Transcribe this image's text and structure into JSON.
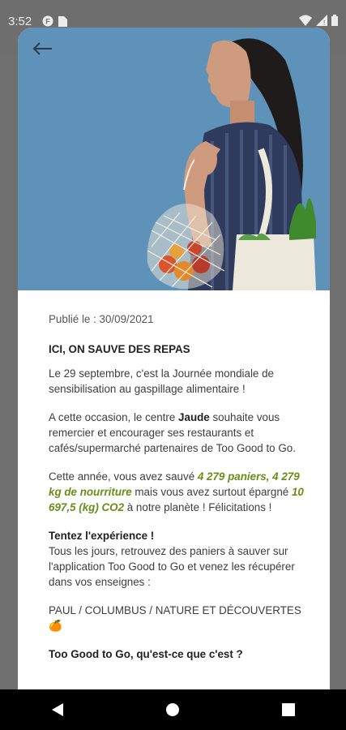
{
  "status_bar": {
    "time": "3:52",
    "icons": [
      "app-notification-icon",
      "sim-card-icon",
      "wifi-icon",
      "signal-icon",
      "battery-icon"
    ]
  },
  "header": {
    "back_icon": "arrow-left-icon"
  },
  "article": {
    "published": "Publié le : 30/09/2021",
    "title": "ICI, ON SAUVE DES REPAS",
    "p1": "Le 29 septembre, c'est la Journée mondiale de sensibilisation au gaspillage alimentaire !",
    "p2": {
      "before": "A cette occasion, le centre ",
      "center": "Jaude",
      "after": " souhaite vous remercier et encourager ses restaurants et cafés/supermarché partenaires de Too Good to Go."
    },
    "p3": {
      "t1": "Cette année, vous avez sauvé ",
      "h1": "4 279 paniers, 4 279 kg de nourriture",
      "t2": " mais vous avez surtout épargné ",
      "h2": "10 697,5 (kg) CO2",
      "t3": " à notre planète ! Félicitations !"
    },
    "p4": {
      "title": "Tentez l'expérience !",
      "body": "Tous les jours, retrouvez des paniers à sauver sur l'application Too Good to Go et venez les récupérer dans vos enseignes :"
    },
    "stores": "PAUL / COLUMBUS / NATURE ET DÉCOUVERTES 🍊",
    "subheading": "Too Good to Go, qu'est-ce que c'est ?"
  },
  "colors": {
    "highlight": "#6a8d18",
    "hero_background": "#5f92b8",
    "nav_bar": "#000000"
  },
  "nav": [
    "back-triangle-icon",
    "home-circle-icon",
    "recents-square-icon"
  ]
}
